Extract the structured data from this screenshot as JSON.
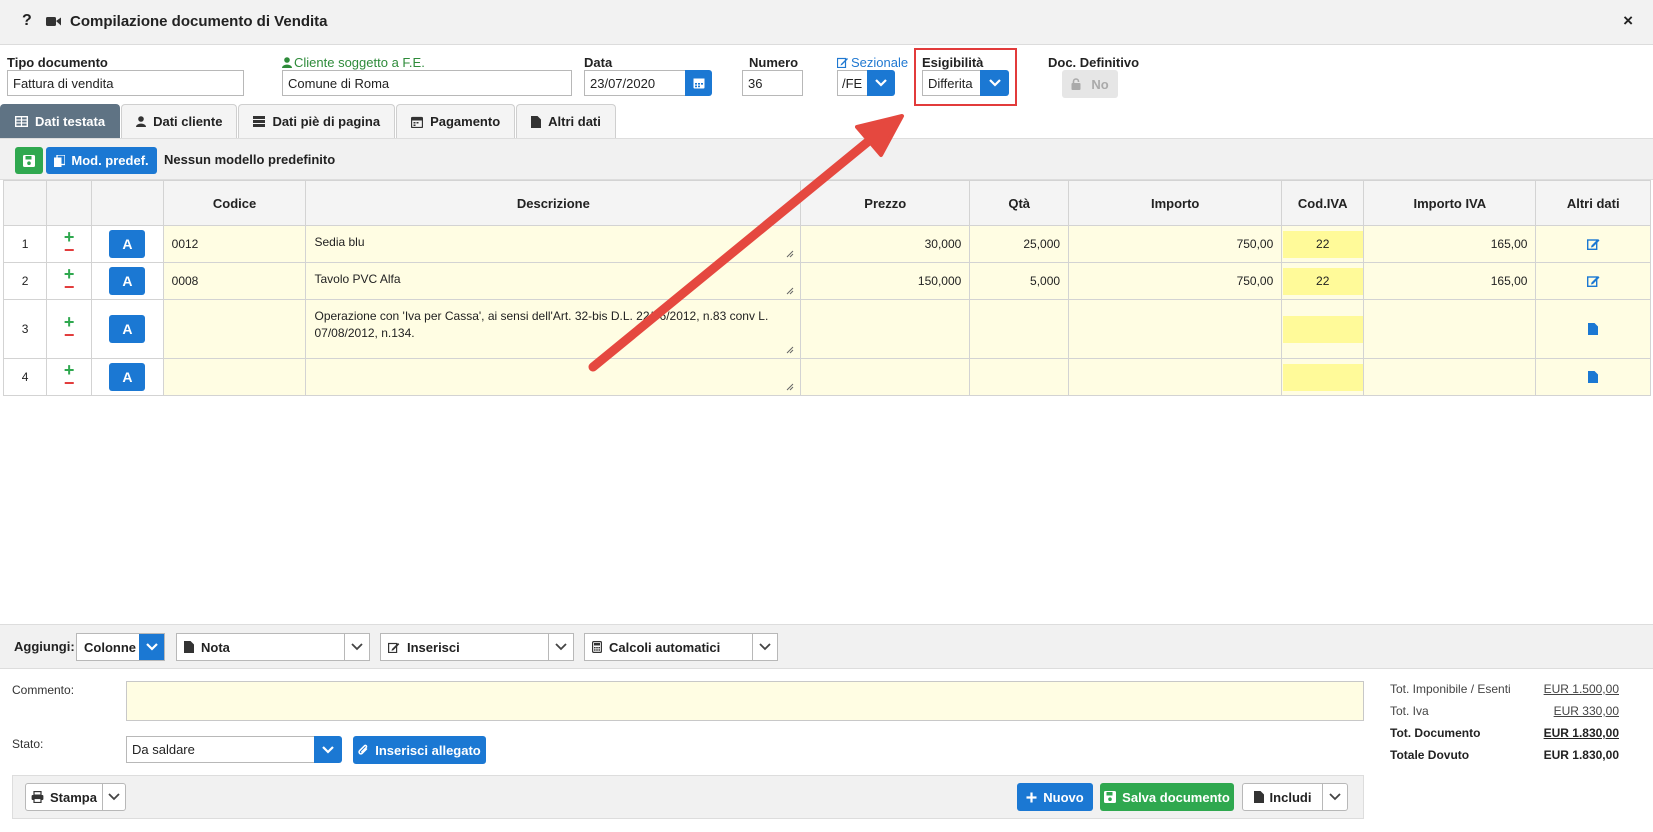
{
  "window": {
    "help_label": "?",
    "title": "Compilazione documento di Vendita",
    "close_label": "×"
  },
  "header": {
    "tipo_label": "Tipo documento",
    "tipo_value": "Fattura di vendita",
    "cliente_label": "Cliente soggetto a F.E.",
    "cliente_value": "Comune di Roma",
    "data_label": "Data",
    "data_value": "23/07/2020",
    "numero_label": "Numero",
    "numero_value": "36",
    "sezionale_label": "Sezionale",
    "sezionale_value": "/FE",
    "esigibilita_label": "Esigibilità",
    "esigibilita_value": "Differita",
    "docdef_label": "Doc. Definitivo",
    "docdef_value": "No"
  },
  "tabs": [
    {
      "label": "Dati testata",
      "active": true
    },
    {
      "label": "Dati cliente"
    },
    {
      "label": "Dati piè di pagina"
    },
    {
      "label": "Pagamento"
    },
    {
      "label": "Altri dati"
    }
  ],
  "toolbar": {
    "mod_label": "Mod. predef.",
    "status_text": "Nessun modello predefinito"
  },
  "table": {
    "columns": [
      "",
      "",
      "",
      "Codice",
      "Descrizione",
      "Prezzo",
      "Qtà",
      "Importo",
      "Cod.IVA",
      "Importo IVA",
      "Altri dati"
    ],
    "rows": [
      {
        "n": "1",
        "btn": "A",
        "codice": "0012",
        "descrizione": "Sedia blu",
        "prezzo": "30,000",
        "qta": "25,000",
        "importo": "750,00",
        "codiva": "22",
        "importo_iva": "165,00"
      },
      {
        "n": "2",
        "btn": "A",
        "codice": "0008",
        "descrizione": "Tavolo PVC Alfa",
        "prezzo": "150,000",
        "qta": "5,000",
        "importo": "750,00",
        "codiva": "22",
        "importo_iva": "165,00"
      },
      {
        "n": "3",
        "btn": "A",
        "codice": "",
        "descrizione": "Operazione con 'Iva per Cassa', ai sensi dell'Art. 32-bis D.L. 22/06/2012, n.83 conv L. 07/08/2012, n.134.",
        "prezzo": "",
        "qta": "",
        "importo": "",
        "codiva": "",
        "importo_iva": ""
      },
      {
        "n": "4",
        "btn": "A",
        "codice": "",
        "descrizione": "",
        "prezzo": "",
        "qta": "",
        "importo": "",
        "codiva": "",
        "importo_iva": ""
      }
    ]
  },
  "addbar": {
    "label": "Aggiungi:",
    "colonne": "Colonne",
    "nota": "Nota",
    "inserisci": "Inserisci",
    "calcoli": "Calcoli automatici"
  },
  "bottom": {
    "commento_label": "Commento:",
    "stato_label": "Stato:",
    "stato_value": "Da saldare",
    "allegato_label": "Inserisci allegato"
  },
  "totals": [
    {
      "label": "Tot. Imponibile / Esenti",
      "value": "EUR 1.500,00"
    },
    {
      "label": "Tot. Iva",
      "value": "EUR 330,00"
    },
    {
      "label": "Tot. Documento",
      "value": "EUR 1.830,00"
    },
    {
      "label": "Totale Dovuto",
      "value": "EUR 1.830,00"
    }
  ],
  "footer": {
    "stampa": "Stampa",
    "nuovo": "Nuovo",
    "salva": "Salva documento",
    "includi": "Includi"
  },
  "colors": {
    "primary": "#1b78d3",
    "success": "#2fa84f",
    "danger": "#e23b3b",
    "tab_active": "#5f7384",
    "row_bg": "#fffde3",
    "iva_bg": "#fffa99"
  }
}
